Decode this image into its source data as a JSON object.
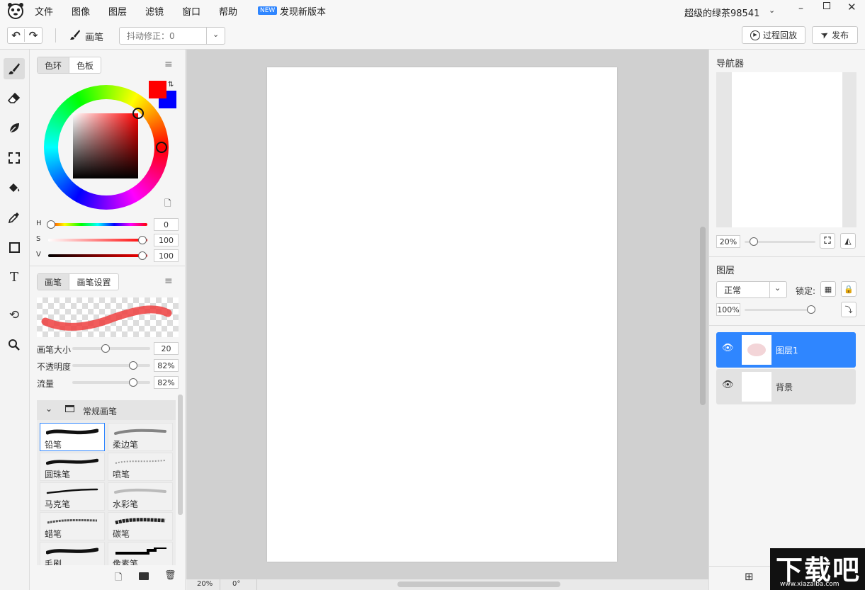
{
  "menu": {
    "items": [
      "文件",
      "图像",
      "图层",
      "滤镜",
      "窗口",
      "帮助"
    ],
    "new_badge": "NEW",
    "new_version": "发现新版本"
  },
  "user": {
    "name": "超级的绿茶98541"
  },
  "toolbar": {
    "brush_label": "画笔",
    "stabilizer": "抖动修正：0",
    "replay": "过程回放",
    "publish": "发布"
  },
  "color": {
    "tab_wheel": "色环",
    "tab_palette": "色板",
    "fg": "#ff0000",
    "bg": "#0000ff",
    "h_label": "H",
    "s_label": "S",
    "v_label": "V",
    "h": "0",
    "s": "100",
    "v": "100"
  },
  "brush": {
    "tab_brush": "画笔",
    "tab_settings": "画笔设置",
    "size_label": "画笔大小",
    "size": "20",
    "opacity_label": "不透明度",
    "opacity": "82%",
    "flow_label": "流量",
    "flow": "82%",
    "group": "常规画笔",
    "items": [
      "铅笔",
      "柔边笔",
      "圆珠笔",
      "喷笔",
      "马克笔",
      "水彩笔",
      "蜡笔",
      "碳笔",
      "毛刷",
      "像素笔"
    ]
  },
  "status": {
    "zoom": "20%",
    "rotation": "0°"
  },
  "navigator": {
    "title": "导航器",
    "zoom": "20%"
  },
  "layers": {
    "title": "图层",
    "blend": "正常",
    "lock_label": "锁定:",
    "opacity": "100%",
    "items": [
      "图层1",
      "背景"
    ]
  },
  "watermark": {
    "text": "下载吧",
    "url": "www.xiazaiba.com"
  },
  "colors": {
    "accent": "#2f86ff",
    "canvas_bg": "#d0d0d0"
  }
}
